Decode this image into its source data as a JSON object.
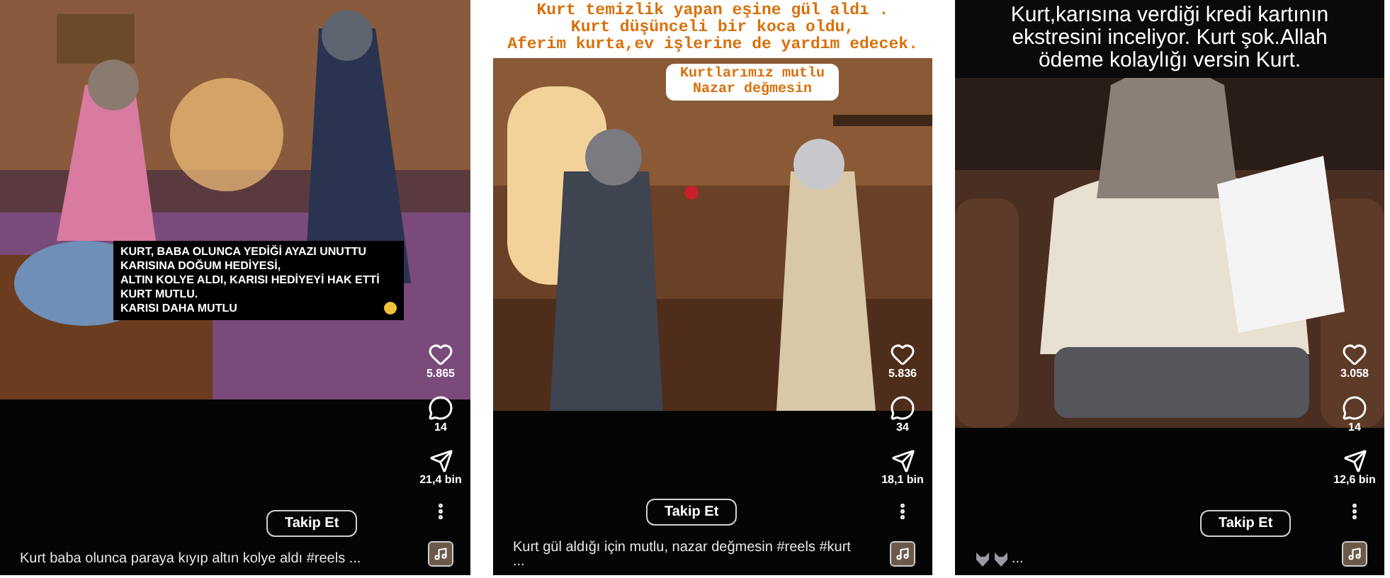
{
  "posts": [
    {
      "picture": {
        "kind": "picture"
      },
      "overlay_caption": {
        "lines": [
          "KURT, BABA OLUNCA YEDİĞİ AYAZI UNUTTU",
          "KARISINA DOĞUM HEDİYESİ,",
          "ALTIN KOLYE ALDI, KARISI HEDİYEYİ HAK ETTİ",
          "KURT MUTLU.",
          "KARISI DAHA MUTLU"
        ]
      },
      "likes": "5.865",
      "comments": "14",
      "shares": "21,4 bin",
      "follow_button": "Takip Et",
      "caption": "Kurt baba olunca paraya kıyıp altın kolye aldı #reels ..."
    },
    {
      "banner": {
        "lines": [
          "Kurt temizlik yapan eşine gül aldı .",
          "Kurt düşünceli bir koca oldu,",
          "Aferim kurta,ev işlerine de yardım edecek."
        ]
      },
      "picture": {
        "kind": "picture"
      },
      "sticker": {
        "lines": [
          "Kurtlarımız mutlu",
          "Nazar değmesin"
        ]
      },
      "likes": "5.836",
      "comments": "34",
      "shares": "18,1 bin",
      "follow_button": "Takip Et",
      "caption": "Kurt gül aldığı için mutlu, nazar değmesin #reels #kurt",
      "caption_more": "..."
    },
    {
      "picture": {
        "kind": "picture"
      },
      "top_text": {
        "lines": [
          "Kurt,karısına verdiği kredi kartının",
          "ekstresini inceliyor. Kurt şok.Allah",
          "ödeme kolaylığı versin  Kurt."
        ]
      },
      "likes": "3.058",
      "comments": "14",
      "shares": "12,6 bin",
      "follow_button": "Takip Et",
      "caption": "...",
      "caption_emojis": [
        {
          "kind": "wolf"
        },
        {
          "kind": "wolf"
        }
      ]
    }
  ]
}
